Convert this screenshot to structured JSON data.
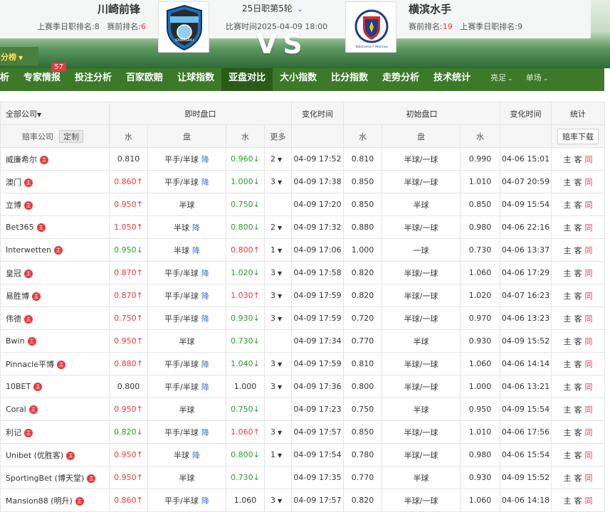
{
  "header": {
    "home": {
      "name": "川崎前锋",
      "last_season_label": "上赛季日职排名:",
      "last_season_rank": "8",
      "pre_rank_label": "赛前排名:",
      "pre_rank": "6"
    },
    "away": {
      "name": "横滨水手",
      "pre_rank_label": "赛前排名:",
      "pre_rank": "19",
      "last_season_label": "上赛季日职排名:",
      "last_season_rank": "9"
    },
    "round": "25日职第5轮",
    "match_time": "比赛时间2025-04-09 18:00",
    "vs": "VS",
    "rank_tab": "分榜",
    "home_logo_text": "KAWASAKI",
    "away_logo_text": "Yokohama F·Marinos"
  },
  "nav": {
    "items": [
      {
        "label": "析"
      },
      {
        "label": "专家情报",
        "badge": "57"
      },
      {
        "label": "投注分析"
      },
      {
        "label": "百家欧赔"
      },
      {
        "label": "让球指数"
      },
      {
        "label": "亚盘对比",
        "active": true
      },
      {
        "label": "大小指数"
      },
      {
        "label": "比分指数"
      },
      {
        "label": "走势分析"
      },
      {
        "label": "技术统计"
      }
    ],
    "right": [
      "亮足",
      "单场"
    ]
  },
  "table": {
    "header1": {
      "all_companies": "全部公司",
      "live": "即时盘口",
      "change_time": "变化时间",
      "initial": "初始盘口",
      "change_time2": "变化时间",
      "stats": "统计"
    },
    "header2": {
      "company": "赔率公司",
      "customize": "定制",
      "water1": "水",
      "line": "盘",
      "water2": "水",
      "more": "更多",
      "iwater1": "水",
      "iline": "盘",
      "iwater2": "水",
      "download": "赔率下载"
    },
    "zhu_label": "主",
    "jiang_label": "降",
    "link_labels": [
      "主",
      "客",
      "同"
    ],
    "rows": [
      {
        "company": "威廉希尔",
        "w1": "0.810",
        "w1dir": "",
        "line": "平手/半球",
        "jiang": true,
        "w2": "0.960",
        "w2dir": "down",
        "more": "2",
        "time": "04-09 17:52",
        "iw1": "0.810",
        "iline": "半球/一球",
        "iw2": "0.990",
        "itime": "04-06 15:01"
      },
      {
        "company": "澳门",
        "w1": "0.860",
        "w1dir": "up",
        "line": "平手/半球",
        "jiang": true,
        "w2": "1.000",
        "w2dir": "down",
        "more": "3",
        "time": "04-09 17:38",
        "iw1": "0.850",
        "iline": "半球/一球",
        "iw2": "1.010",
        "itime": "04-07 20:59"
      },
      {
        "company": "立博",
        "w1": "0.950",
        "w1dir": "up",
        "line": "半球",
        "jiang": false,
        "w2": "0.750",
        "w2dir": "down",
        "more": "",
        "time": "04-09 17:20",
        "iw1": "0.850",
        "iline": "半球",
        "iw2": "0.850",
        "itime": "04-09 15:54"
      },
      {
        "company": "Bet365",
        "w1": "1.050",
        "w1dir": "up",
        "line": "半球",
        "jiang": true,
        "w2": "0.800",
        "w2dir": "down",
        "more": "2",
        "time": "04-09 17:32",
        "iw1": "0.880",
        "iline": "半球/一球",
        "iw2": "0.980",
        "itime": "04-06 22:16"
      },
      {
        "company": "Interwetten",
        "w1": "0.950",
        "w1dir": "down",
        "line": "半球",
        "jiang": true,
        "w2": "0.800",
        "w2dir": "up",
        "more": "1",
        "time": "04-09 17:06",
        "iw1": "1.000",
        "iline": "一球",
        "iw2": "0.730",
        "itime": "04-06 13:37"
      },
      {
        "company": "皇冠",
        "w1": "0.870",
        "w1dir": "up",
        "line": "平手/半球",
        "jiang": true,
        "w2": "1.020",
        "w2dir": "down",
        "more": "3",
        "time": "04-09 17:58",
        "iw1": "0.820",
        "iline": "半球/一球",
        "iw2": "1.060",
        "itime": "04-06 17:29"
      },
      {
        "company": "易胜博",
        "w1": "0.870",
        "w1dir": "up",
        "line": "平手/半球",
        "jiang": true,
        "w2": "1.030",
        "w2dir": "up",
        "more": "3",
        "time": "04-09 17:59",
        "iw1": "0.820",
        "iline": "半球/一球",
        "iw2": "1.020",
        "itime": "04-07 16:23"
      },
      {
        "company": "伟德",
        "w1": "0.750",
        "w1dir": "up",
        "line": "平手/半球",
        "jiang": true,
        "w2": "0.930",
        "w2dir": "down",
        "more": "3",
        "time": "04-09 17:59",
        "iw1": "0.720",
        "iline": "半球/一球",
        "iw2": "0.970",
        "itime": "04-06 13:23"
      },
      {
        "company": "Bwin",
        "w1": "0.950",
        "w1dir": "up",
        "line": "半球",
        "jiang": false,
        "w2": "0.730",
        "w2dir": "down",
        "more": "",
        "time": "04-09 17:34",
        "iw1": "0.770",
        "iline": "半球",
        "iw2": "0.930",
        "itime": "04-09 15:52"
      },
      {
        "company": "Pinnacle平博",
        "w1": "0.880",
        "w1dir": "up",
        "line": "平手/半球",
        "jiang": true,
        "w2": "1.040",
        "w2dir": "down",
        "more": "3",
        "time": "04-09 17:59",
        "iw1": "0.810",
        "iline": "半球/一球",
        "iw2": "1.060",
        "itime": "04-06 14:14"
      },
      {
        "company": "10BET",
        "w1": "0.800",
        "w1dir": "",
        "line": "平手/半球",
        "jiang": true,
        "w2": "1.000",
        "w2dir": "",
        "more": "3",
        "time": "04-09 17:36",
        "iw1": "0.800",
        "iline": "半球/一球",
        "iw2": "1.000",
        "itime": "04-06 13:21"
      },
      {
        "company": "Coral",
        "w1": "0.950",
        "w1dir": "up",
        "line": "半球",
        "jiang": false,
        "w2": "0.750",
        "w2dir": "down",
        "more": "",
        "time": "04-09 17:23",
        "iw1": "0.750",
        "iline": "半球",
        "iw2": "0.950",
        "itime": "04-09 15:54"
      },
      {
        "company": "利记",
        "w1": "0.820",
        "w1dir": "down",
        "line": "平手/半球",
        "jiang": true,
        "w2": "1.060",
        "w2dir": "up",
        "more": "3",
        "time": "04-09 17:57",
        "iw1": "0.850",
        "iline": "半球/一球",
        "iw2": "1.010",
        "itime": "04-06 17:56"
      },
      {
        "company": "Unibet (优胜客)",
        "w1": "0.950",
        "w1dir": "up",
        "line": "半球",
        "jiang": true,
        "w2": "0.800",
        "w2dir": "down",
        "more": "1",
        "time": "04-09 17:54",
        "iw1": "0.780",
        "iline": "半球/一球",
        "iw2": "0.980",
        "itime": "04-06 15:54"
      },
      {
        "company": "SportingBet (博天堂)",
        "w1": "0.950",
        "w1dir": "up",
        "line": "半球",
        "jiang": false,
        "w2": "0.730",
        "w2dir": "down",
        "more": "",
        "time": "04-09 17:35",
        "iw1": "0.770",
        "iline": "半球",
        "iw2": "0.930",
        "itime": "04-09 15:52"
      },
      {
        "company": "Mansion88 (明升)",
        "w1": "0.860",
        "w1dir": "up",
        "line": "平手/半球",
        "jiang": true,
        "w2": "1.060",
        "w2dir": "",
        "more": "3",
        "time": "04-09 17:57",
        "iw1": "0.820",
        "iline": "半球/一球",
        "iw2": "1.060",
        "itime": "04-06 14:18"
      }
    ]
  },
  "colors": {
    "nav_green": "#3c7a2a",
    "up_red": "#e4393c",
    "down_green": "#2d9a2d",
    "link_blue": "#3572c8"
  }
}
